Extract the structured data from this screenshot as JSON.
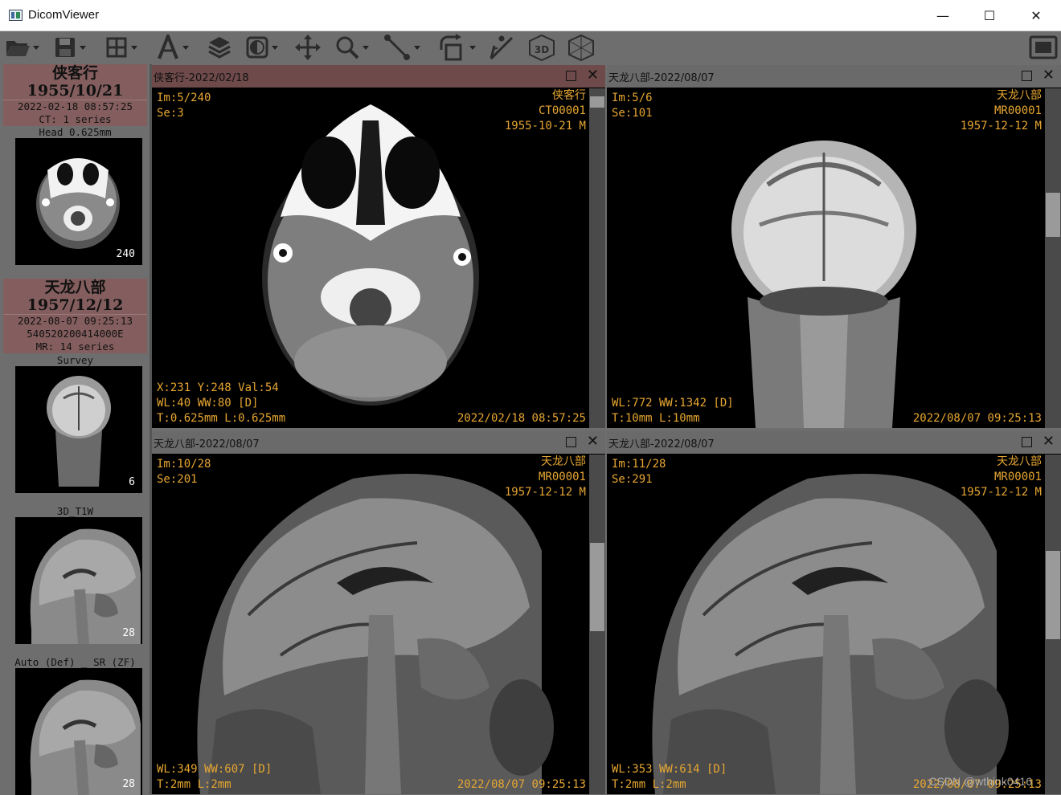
{
  "window": {
    "title": "DicomViewer",
    "minimize": "—",
    "maximize": "☐",
    "close": "✕"
  },
  "toolbar": {
    "items": [
      "open-folder",
      "save",
      "layout-grid",
      "annotation-text",
      "layers",
      "window-level",
      "pan",
      "zoom",
      "measure-line",
      "rotate",
      "angle",
      "3d",
      "mpr",
      "fullscreen"
    ]
  },
  "sidebar": {
    "patients": [
      {
        "name": "侠客行",
        "dob": "1955/10/21",
        "datetime": "2022-02-18 08:57:25",
        "id": "",
        "series_count": "CT: 1 series",
        "series": [
          {
            "label": "Head 0.625mm",
            "count": "240"
          }
        ]
      },
      {
        "name": "天龙八部",
        "dob": "1957/12/12",
        "datetime": "2022-08-07 09:25:13",
        "id": "540520200414000E",
        "series_count": "MR: 14 series",
        "series": [
          {
            "label": "Survey",
            "count": "6"
          },
          {
            "label": "3D_T1W",
            "count": "28"
          },
          {
            "label": "Auto (Def) _ SR (ZF)",
            "count": "28"
          }
        ]
      }
    ]
  },
  "panes": [
    {
      "title": "侠客行-2022/02/18",
      "tl": "Im:5/240\nSe:3",
      "tr": "侠客行\nCT00001\n1955-10-21 M",
      "bl": "X:231 Y:248 Val:54\nWL:40 WW:80 [D]\nT:0.625mm L:0.625mm",
      "br": "2022/02/18 08:57:25"
    },
    {
      "title": "天龙八部-2022/08/07",
      "tl": "Im:5/6\nSe:101",
      "tr": "天龙八部\nMR00001\n1957-12-12 M",
      "bl": "WL:772 WW:1342 [D]\nT:10mm L:10mm",
      "br": "2022/08/07 09:25:13"
    },
    {
      "title": "天龙八部-2022/08/07",
      "tl": "Im:10/28\nSe:201",
      "tr": "天龙八部\nMR00001\n1957-12-12 M",
      "bl": "WL:349 WW:607 [D]\nT:2mm L:2mm",
      "br": "2022/08/07 09:25:13"
    },
    {
      "title": "天龙八部-2022/08/07",
      "tl": "Im:11/28\nSe:291",
      "tr": "天龙八部\nMR00001\n1957-12-12 M",
      "bl": "WL:353 WW:614 [D]\nT:2mm L:2mm",
      "br": "2022/08/07 09:25:13"
    }
  ],
  "watermark": "CSDN @wthink0416"
}
